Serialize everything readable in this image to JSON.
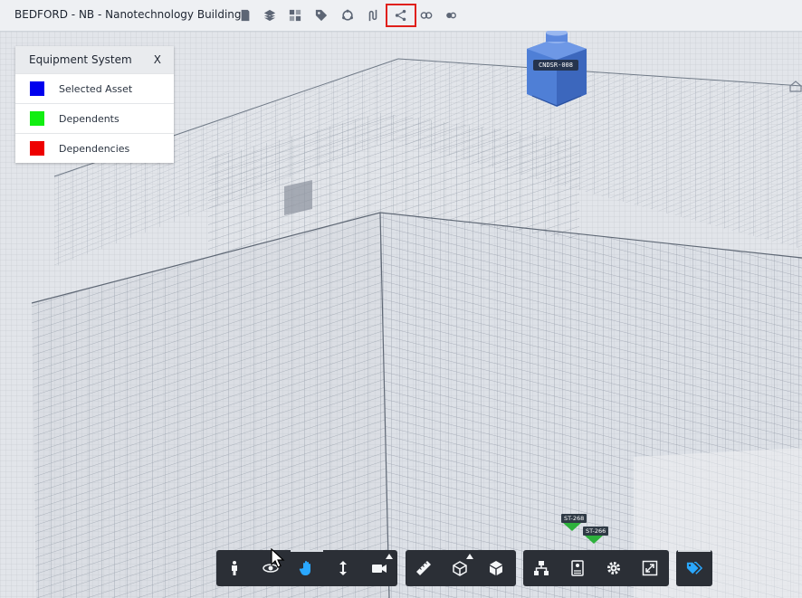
{
  "app": {
    "title": "BEDFORD - NB - Nanotechnology Building"
  },
  "top_toolbar": {
    "icons": [
      "book-icon",
      "layers-icon",
      "grid-icon",
      "tag-icon",
      "cycle-icon",
      "route-icon",
      "share-network-icon",
      "equipment-left-icon",
      "equipment-right-icon"
    ],
    "highlighted": "share-network-icon"
  },
  "legend": {
    "title": "Equipment System",
    "close_label": "X",
    "items": [
      {
        "label": "Selected Asset",
        "color": "#0000ee"
      },
      {
        "label": "Dependents",
        "color": "#11ee11"
      },
      {
        "label": "Dependencies",
        "color": "#ee0000"
      }
    ]
  },
  "asset": {
    "label": "CNDSR-008",
    "color": "#4f7fd6"
  },
  "tags": [
    {
      "label": "ST-268"
    },
    {
      "label": "ST-266"
    }
  ],
  "bottom_toolbar": {
    "groups": [
      [
        "person-icon",
        "orbit-icon",
        "hand-pan-icon",
        "vertical-move-icon",
        "camera-icon"
      ],
      [
        "ruler-icon",
        "section-box-icon",
        "cube-icon"
      ],
      [
        "hierarchy-icon",
        "properties-icon",
        "settings-icon",
        "fullscreen-icon"
      ],
      [
        "tags-icon"
      ]
    ],
    "active": "hand-pan-icon"
  },
  "colors": {
    "highlight_outline": "#e0201a",
    "active_tool": "#2aa8ff",
    "toolbar_bg": "#2b2f36"
  }
}
